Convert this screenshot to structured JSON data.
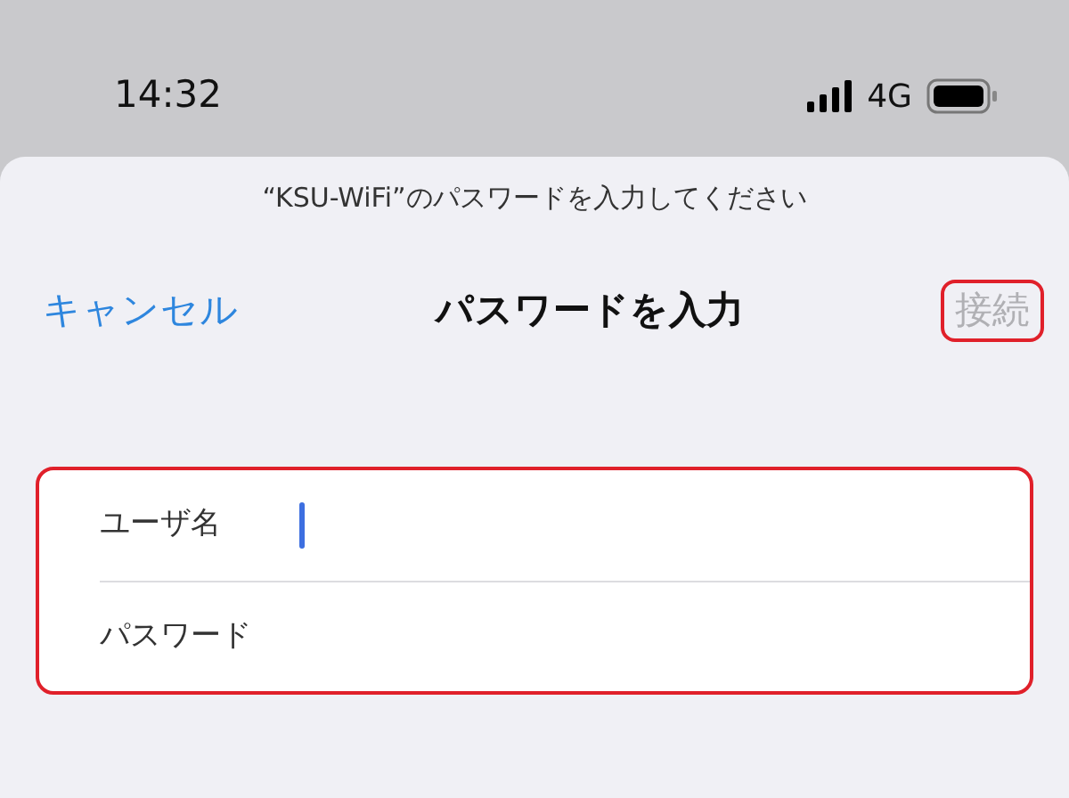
{
  "status_bar": {
    "time": "14:32",
    "network": "4G"
  },
  "prompt": "“KSU-WiFi”のパスワードを入力してください",
  "nav": {
    "cancel": "キャンセル",
    "title": "パスワードを入力",
    "connect": {
      "label": "接続",
      "disabled": true,
      "highlighted": true
    }
  },
  "form": {
    "highlighted": true,
    "fields": [
      {
        "label": "ユーザ名",
        "focused": true
      },
      {
        "label": "パスワード",
        "focused": false
      }
    ]
  }
}
